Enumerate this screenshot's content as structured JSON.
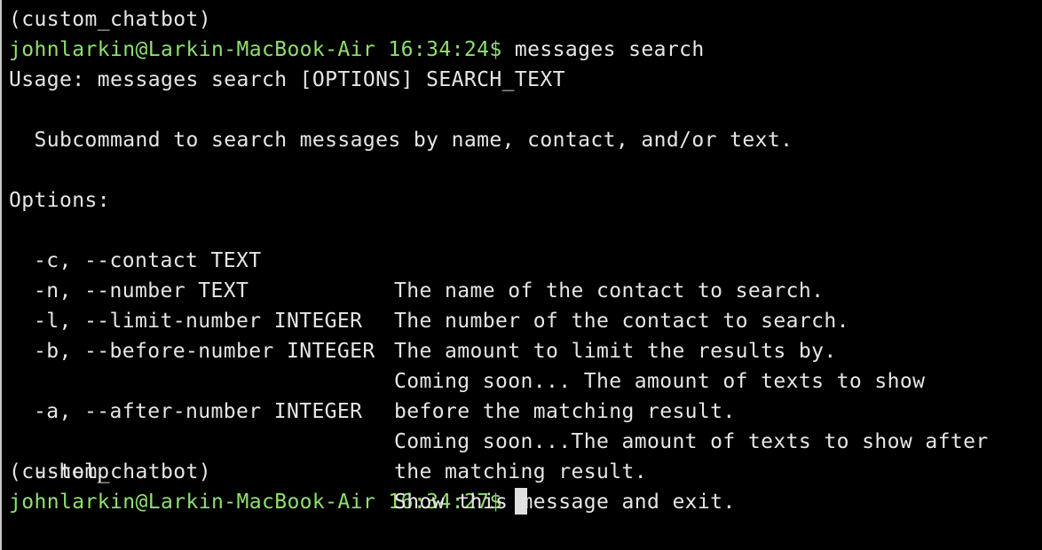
{
  "terminal": {
    "env_line_1": "(custom_chatbot)",
    "prompt_1": "johnlarkin@Larkin-MacBook-Air 16:34:24$",
    "command_1": " messages search",
    "usage": "Usage: messages search [OPTIONS] SEARCH_TEXT",
    "description": "  Subcommand to search messages by name, contact, and/or text.",
    "options_header": "Options:",
    "options": [
      {
        "flag": "-c, --contact TEXT",
        "desc": "The name of the contact to search."
      },
      {
        "flag": "-n, --number TEXT",
        "desc": "The number of the contact to search."
      },
      {
        "flag": "-l, --limit-number INTEGER",
        "desc": "The amount to limit the results by."
      },
      {
        "flag": "-b, --before-number INTEGER",
        "desc": "Coming soon... The amount of texts to show"
      },
      {
        "flag": "",
        "desc": "before the matching result."
      },
      {
        "flag": "-a, --after-number INTEGER",
        "desc": "Coming soon...The amount of texts to show after"
      },
      {
        "flag": "",
        "desc": "the matching result."
      },
      {
        "flag": "--help",
        "desc": "Show this message and exit."
      }
    ],
    "env_line_2": "(custom_chatbot)",
    "prompt_2": "johnlarkin@Larkin-MacBook-Air 16:34:27$",
    "colors": {
      "background": "#000000",
      "text": "#e6e6e6",
      "prompt": "#8fe06e",
      "cursor": "#e0e0e0"
    }
  }
}
